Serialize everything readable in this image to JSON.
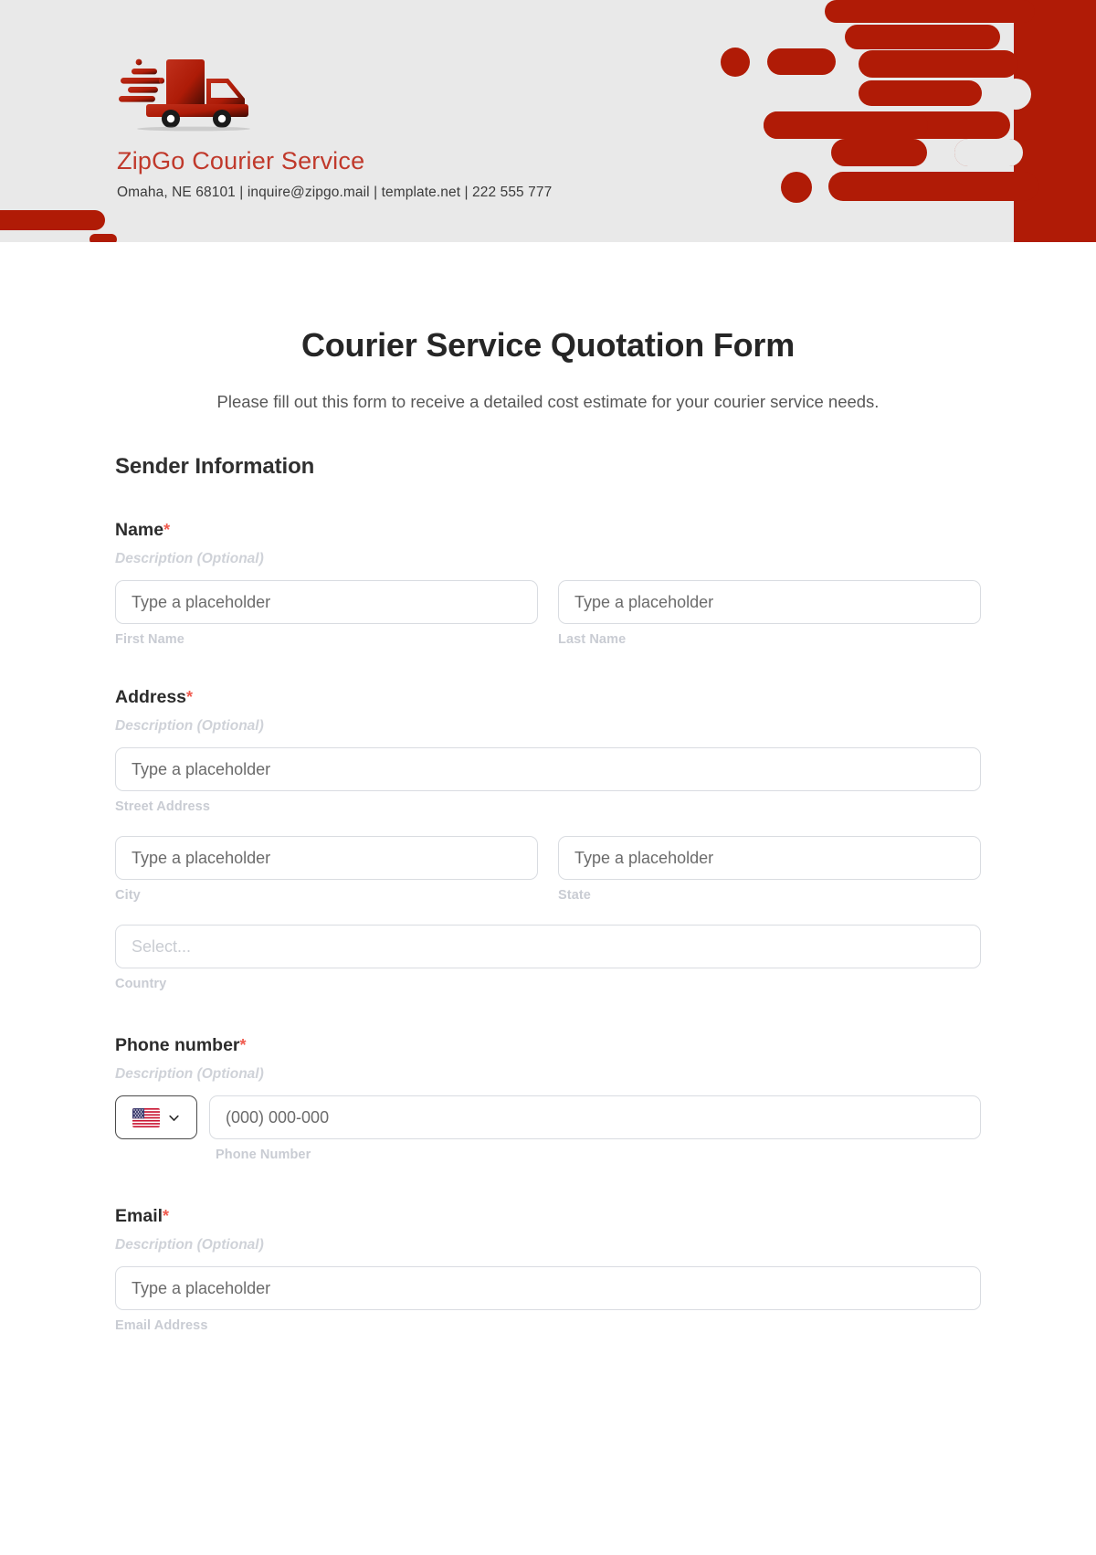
{
  "header": {
    "brand_name": "ZipGo Courier Service",
    "contact_line": "Omaha, NE 68101 | inquire@zipgo.mail | template.net | 222 555 777",
    "logo_icon": "delivery-truck-icon",
    "motif_icon": "speed-lines-motif",
    "colors": {
      "background": "#e9e9e9",
      "brand_red": "#b01b06",
      "brand_text_red": "#c0392b"
    }
  },
  "form": {
    "title": "Courier Service Quotation Form",
    "description": "Please fill out this form to receive a detailed cost estimate for your courier service needs.",
    "section_title": "Sender Information",
    "required_marker": "*",
    "description_placeholder": "Description (Optional)",
    "fields": {
      "name": {
        "label": "Name",
        "description": "Description (Optional)",
        "first": {
          "placeholder": "Type a placeholder",
          "sub_label": "First Name",
          "value": ""
        },
        "last": {
          "placeholder": "Type a placeholder",
          "sub_label": "Last Name",
          "value": ""
        }
      },
      "address": {
        "label": "Address",
        "description": "Description (Optional)",
        "street": {
          "placeholder": "Type a placeholder",
          "sub_label": "Street Address",
          "value": ""
        },
        "city": {
          "placeholder": "Type a placeholder",
          "sub_label": "City",
          "value": ""
        },
        "state": {
          "placeholder": "Type a placeholder",
          "sub_label": "State",
          "value": ""
        },
        "country": {
          "placeholder": "Select...",
          "sub_label": "Country",
          "value": ""
        }
      },
      "phone": {
        "label": "Phone number",
        "description": "Description (Optional)",
        "country_flag": "us-flag-icon",
        "dropdown_icon": "chevron-down-icon",
        "placeholder": "(000) 000-000",
        "sub_label": "Phone Number",
        "value": ""
      },
      "email": {
        "label": "Email",
        "description": "Description (Optional)",
        "placeholder": "Type a placeholder",
        "sub_label": "Email Address",
        "value": ""
      }
    }
  }
}
